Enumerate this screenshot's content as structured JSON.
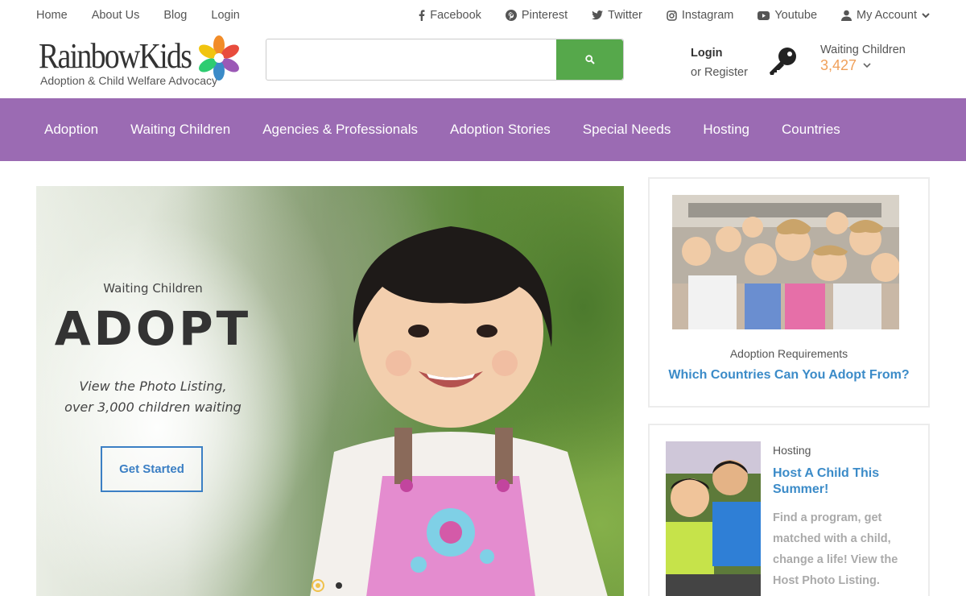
{
  "top_links": [
    "Home",
    "About Us",
    "Blog",
    "Login"
  ],
  "social": [
    {
      "label": "Facebook",
      "icon": "facebook-icon"
    },
    {
      "label": "Pinterest",
      "icon": "pinterest-icon"
    },
    {
      "label": "Twitter",
      "icon": "twitter-icon"
    },
    {
      "label": "Instagram",
      "icon": "instagram-icon"
    },
    {
      "label": "Youtube",
      "icon": "youtube-icon"
    }
  ],
  "account": {
    "label": "My Account",
    "icon": "user-icon"
  },
  "logo": {
    "name": "RainbowKids",
    "tagline": "Adoption & Child Welfare Advocacy"
  },
  "search": {
    "placeholder": "",
    "value": "",
    "icon": "search-icon",
    "button_color": "#56a84b"
  },
  "auth": {
    "login": "Login",
    "or": "or",
    "register": "Register",
    "icon": "key-icon"
  },
  "waiting": {
    "label": "Waiting Children",
    "count": "3,427",
    "count_color": "#f0a05a"
  },
  "nav": {
    "color": "#9b6bb3",
    "items": [
      "Adoption",
      "Waiting Children",
      "Agencies & Professionals",
      "Adoption Stories",
      "Special Needs",
      "Hosting",
      "Countries"
    ]
  },
  "hero": {
    "subtitle": "Waiting Children",
    "title": "ADOPT",
    "desc_line1": "View the Photo Listing,",
    "desc_line2": "over 3,000 children waiting",
    "cta": "Get Started",
    "slides": 2,
    "active_slide": 1
  },
  "cards": [
    {
      "category": "Adoption Requirements",
      "link": "Which Countries Can You Adopt From?"
    },
    {
      "category": "Hosting",
      "link": "Host A Child This Summer!",
      "desc": "Find a program, get matched with a child, change a life! View the Host Photo Listing."
    }
  ],
  "colors": {
    "link": "#3b8bc8",
    "cta_border": "#3b7fc4"
  }
}
